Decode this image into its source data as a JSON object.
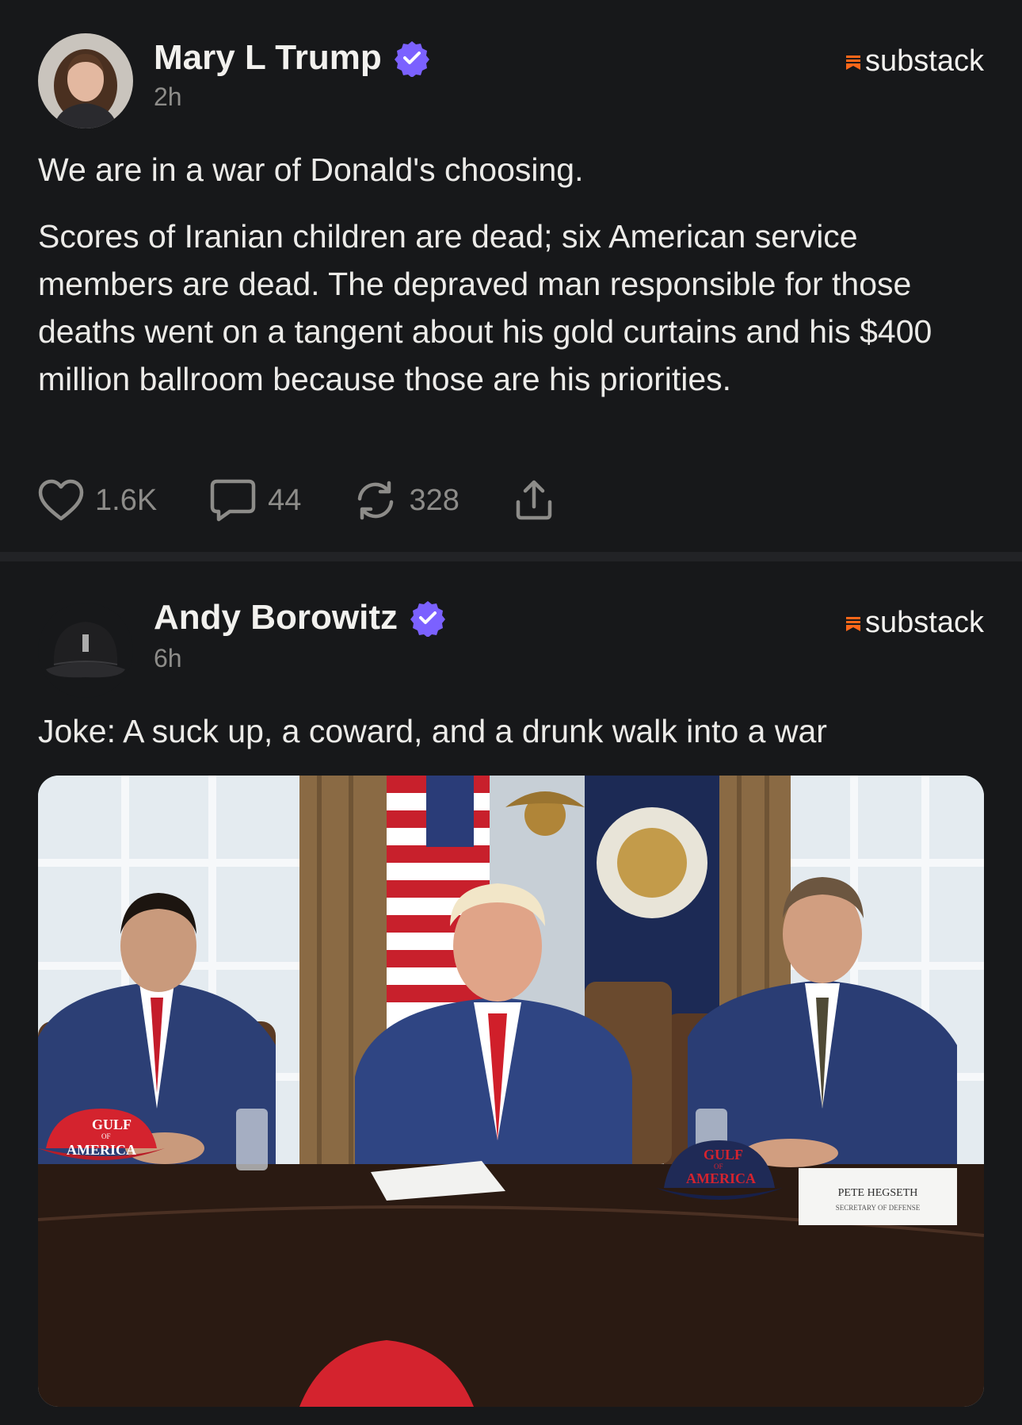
{
  "posts": [
    {
      "author": "Mary L Trump",
      "time": "2h",
      "brand": "substack",
      "paragraphs": [
        "We are in a war of Donald's choosing.",
        "Scores of Iranian children are dead; six American service members are dead.  The depraved man responsible for those deaths went on a tangent about his gold curtains and his $400 million ballroom because those are his priorities."
      ],
      "likes": "1.6K",
      "comments": "44",
      "restacks": "328"
    },
    {
      "author": "Andy Borowitz",
      "time": "6h",
      "brand": "substack",
      "text": "Joke: A suck up, a coward, and a drunk walk into a war",
      "image": {
        "hat_left": [
          "GULF",
          "OF",
          "AMERICA"
        ],
        "hat_right": [
          "GULF",
          "OF",
          "AMERICA"
        ],
        "nameplate": [
          "PETE HEGSETH",
          "SECRETARY OF DEFENSE"
        ]
      }
    }
  ],
  "colors": {
    "background": "#17181a",
    "verified": "#7b61ff",
    "brand_accent": "#ff6719",
    "muted": "#8d8c89"
  },
  "icons": [
    "verified-icon",
    "substack-logo-icon",
    "heart-icon",
    "comment-icon",
    "restack-icon",
    "share-icon"
  ]
}
